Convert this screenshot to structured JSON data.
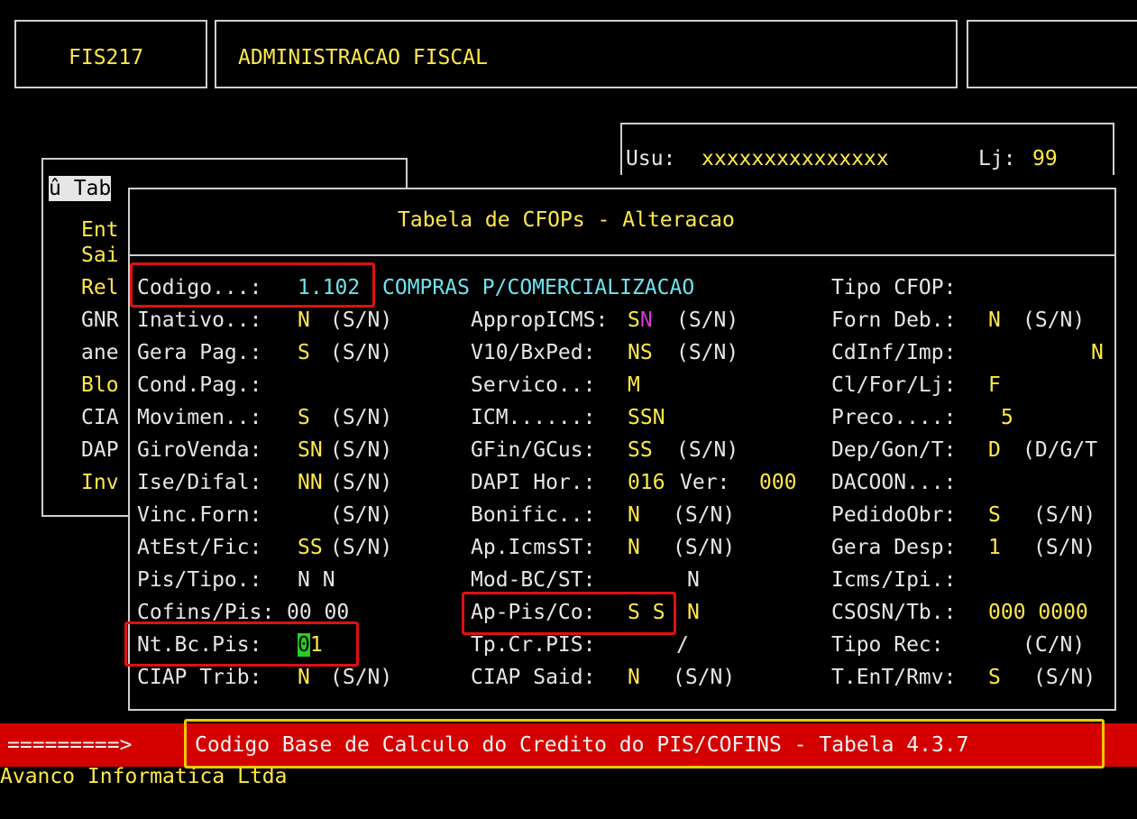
{
  "header": {
    "program_code": "FIS217",
    "program_title": "ADMINISTRACAO FISCAL"
  },
  "user_box": {
    "user_label": "Usu:",
    "user_value": "xxxxxxxxxxxxxxx",
    "store_label": "Lj:",
    "store_value": "99"
  },
  "back_menu": {
    "items": [
      "û Tab",
      "Ent",
      "Sai",
      "Rel",
      "GNR",
      "ane",
      "Blo",
      "CIA",
      "DAP",
      "Inv"
    ]
  },
  "dialog": {
    "title": "Tabela de CFOPs - Alteracao",
    "codigo_label": "Codigo...:",
    "codigo_value": "1.102",
    "codigo_desc": "COMPRAS P/COMERCIALIZACAO",
    "tipo_cfop_label": "Tipo CFOP:",
    "col1": [
      {
        "label": "Inativo..:",
        "value": "N",
        "hint": "(S/N)"
      },
      {
        "label": "Gera Pag.:",
        "value": "S",
        "hint": "(S/N)"
      },
      {
        "label": "Cond.Pag.:",
        "value": "",
        "hint": ""
      },
      {
        "label": "Movimen..:",
        "value": "S",
        "hint": "(S/N)"
      },
      {
        "label": "GiroVenda:",
        "value": "SN",
        "hint": "(S/N)"
      },
      {
        "label": "Ise/Difal:",
        "value": "NN",
        "hint": "(S/N)"
      },
      {
        "label": "Vinc.Forn:",
        "value": "",
        "hint": "(S/N)"
      },
      {
        "label": "AtEst/Fic:",
        "value": "SS",
        "hint": "(S/N)"
      },
      {
        "label": "Pis/Tipo.:",
        "value": "N N",
        "hint": ""
      },
      {
        "label": "Cofins/Pis:",
        "value": "00 00",
        "hint": ""
      },
      {
        "label": "Nt.Bc.Pis:",
        "value_cursor": "0",
        "value_rest": "1"
      },
      {
        "label": "CIAP Trib:",
        "value": "N",
        "hint": "(S/N)"
      }
    ],
    "col2": [
      {
        "label": "AppropICMS:",
        "v1": "S",
        "v2": "N",
        "hint": "(S/N)"
      },
      {
        "label": "V10/BxPed:",
        "value": "NS",
        "hint": "(S/N)"
      },
      {
        "label": "Servico..:",
        "value": "M",
        "hint": ""
      },
      {
        "label": "ICM......:",
        "value": "SSN",
        "hint": ""
      },
      {
        "label": "GFin/GCus:",
        "value": "SS",
        "hint": "(S/N)"
      },
      {
        "label": "DAPI Hor.:",
        "value": "016",
        "extra_label": "Ver:",
        "extra_value": "000"
      },
      {
        "label": "Bonific..:",
        "value": "N",
        "hint": "(S/N)"
      },
      {
        "label": "Ap.IcmsST:",
        "value": "N",
        "hint": "(S/N)"
      },
      {
        "label": "Mod-BC/ST:",
        "value": "N",
        "hint": ""
      },
      {
        "label": "Ap-Pis/Co:",
        "value": "S S",
        "extra_value": "N"
      },
      {
        "label": "Tp.Cr.PIS:",
        "value": "/",
        "hint": ""
      },
      {
        "label": "CIAP Said:",
        "value": "N",
        "hint": "(S/N)"
      }
    ],
    "col3": [
      {
        "label": "Forn Deb.:",
        "value": "N",
        "hint": "(S/N)"
      },
      {
        "label": "CdInf/Imp:",
        "value": "N",
        "hint": ""
      },
      {
        "label": "Cl/For/Lj:",
        "value": "F",
        "hint": ""
      },
      {
        "label": "Preco....:",
        "value": "5",
        "hint": ""
      },
      {
        "label": "Dep/Gon/T:",
        "value": "D",
        "hint": "(D/G/T"
      },
      {
        "label": "DACOON...:",
        "value": "",
        "hint": ""
      },
      {
        "label": "PedidoObr:",
        "value": "S",
        "hint": "(S/N)"
      },
      {
        "label": "Gera Desp:",
        "value": "1",
        "hint": "(S/N)"
      },
      {
        "label": "Icms/Ipi.:",
        "value": "",
        "hint": ""
      },
      {
        "label": "CSOSN/Tb.:",
        "value": "000 0000",
        "hint": ""
      },
      {
        "label": "Tipo Rec:",
        "value": "",
        "hint": "(C/N)"
      },
      {
        "label": "T.EnT/Rmv:",
        "value": "S",
        "hint": "(S/N)"
      }
    ]
  },
  "status_bar": {
    "arrow": "=========>",
    "message": "Codigo Base de Calculo do Credito do PIS/COFINS - Tabela 4.3.7"
  },
  "footer": {
    "company": "Avanco Informatica Ltda"
  },
  "colors": {
    "background": "#000000",
    "label": "#e6e6e6",
    "value": "#ffe94a",
    "highlight_cyan": "#6fe3ee",
    "status_bar": "#d40000",
    "cursor": "#21d021",
    "annotation_red": "#e01010",
    "annotation_yellow": "#f3c800"
  }
}
